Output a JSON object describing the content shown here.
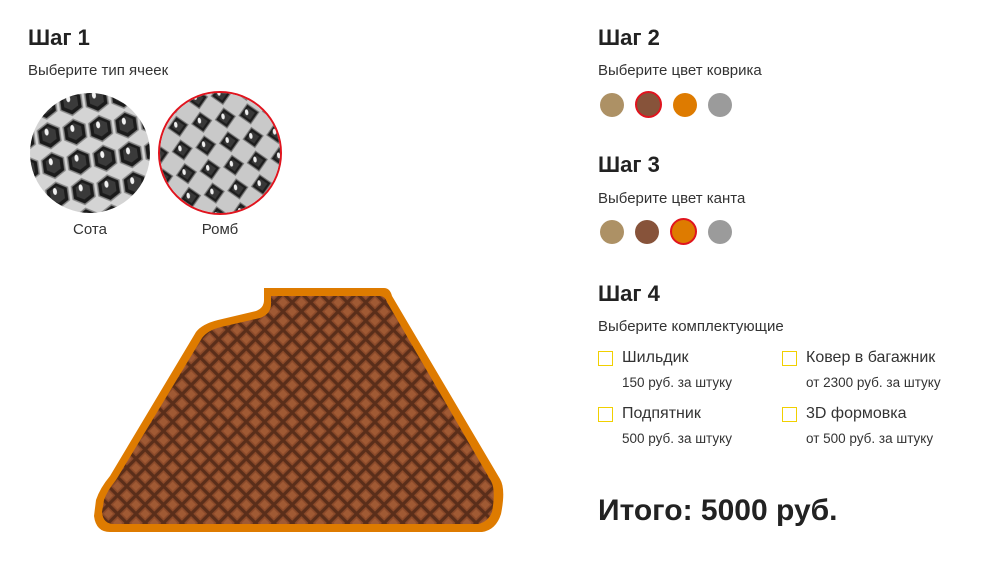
{
  "step1": {
    "title": "Шаг 1",
    "subtitle": "Выберите тип ячеек",
    "options": [
      {
        "label": "Сота",
        "selected": false
      },
      {
        "label": "Ромб",
        "selected": true
      }
    ]
  },
  "step2": {
    "title": "Шаг 2",
    "subtitle": "Выберите цвет коврика",
    "colors": [
      {
        "hex": "#ad9165",
        "selected": false
      },
      {
        "hex": "#87533a",
        "selected": true
      },
      {
        "hex": "#de7b00",
        "selected": false
      },
      {
        "hex": "#9b9b9b",
        "selected": false
      }
    ]
  },
  "step3": {
    "title": "Шаг 3",
    "subtitle": "Выберите цвет канта",
    "colors": [
      {
        "hex": "#ad9165",
        "selected": false
      },
      {
        "hex": "#87533a",
        "selected": false
      },
      {
        "hex": "#de7b00",
        "selected": true
      },
      {
        "hex": "#9b9b9b",
        "selected": false
      }
    ]
  },
  "step4": {
    "title": "Шаг 4",
    "subtitle": "Выберите комплектующие",
    "items": [
      {
        "name": "Шильдик",
        "price": "150 руб. за штуку",
        "checked": false
      },
      {
        "name": "Ковер в багажник",
        "price": "от 2300 руб. за штуку",
        "checked": false
      },
      {
        "name": "Подпятник",
        "price": "500 руб. за штуку",
        "checked": false
      },
      {
        "name": "3D формовка",
        "price": "от 500 руб. за штуку",
        "checked": false
      }
    ]
  },
  "total": "Итого: 5000 руб.",
  "preview": {
    "mat_color": "#87533a",
    "edge_color": "#de7b00"
  }
}
